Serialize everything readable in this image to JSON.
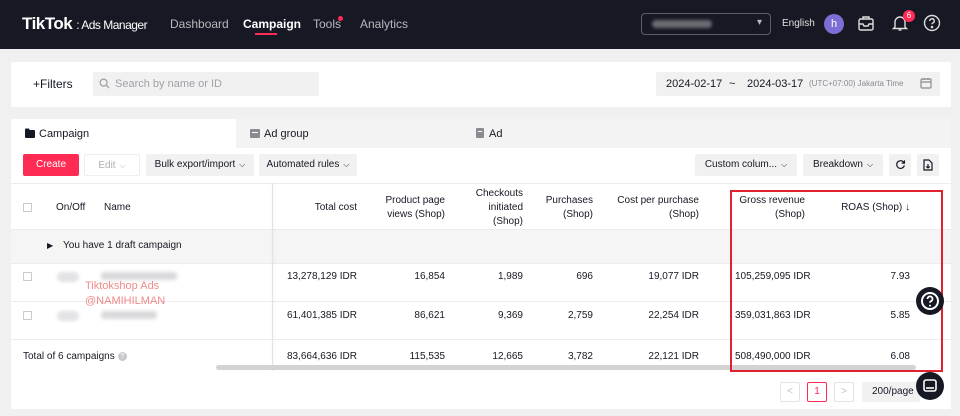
{
  "topnav": {
    "brand": "TikTok",
    "brand_sub": ": Ads Manager",
    "items": [
      {
        "label": "Dashboard"
      },
      {
        "label": "Campaign"
      },
      {
        "label": "Tools"
      },
      {
        "label": "Analytics"
      }
    ],
    "language": "English",
    "avatar_letter": "h",
    "notification_count": "6"
  },
  "filterbar": {
    "filters_label": "+Filters",
    "search_placeholder": "Search by name or ID",
    "date_start": "2024-02-17",
    "date_sep": "~",
    "date_end": "2024-03-17",
    "timezone": "(UTC+07:00) Jakarta Time"
  },
  "tabs": [
    {
      "label": "Campaign"
    },
    {
      "label": "Ad group"
    },
    {
      "label": "Ad"
    }
  ],
  "toolbar": {
    "create": "Create",
    "edit": "Edit",
    "bulk": "Bulk export/import",
    "rules": "Automated rules",
    "custom_columns": "Custom colum...",
    "breakdown": "Breakdown"
  },
  "table": {
    "headers": {
      "onoff": "On/Off",
      "name": "Name",
      "total_cost": "Total cost",
      "ppv_1": "Product page",
      "ppv_2": "views (Shop)",
      "checkouts_1": "Checkouts",
      "checkouts_2": "initiated",
      "checkouts_3": "(Shop)",
      "purchases_1": "Purchases",
      "purchases_2": "(Shop)",
      "cpp_1": "Cost per purchase",
      "cpp_2": "(Shop)",
      "gross_1": "Gross revenue",
      "gross_2": "(Shop)",
      "roas": "ROAS (Shop) ↓"
    },
    "draft_text": "You have 1 draft campaign",
    "rows": [
      {
        "total_cost": "13,278,129 IDR",
        "ppv": "16,854",
        "checkouts": "1,989",
        "purchases": "696",
        "cpp": "19,077 IDR",
        "gross": "105,259,095 IDR",
        "roas": "7.93"
      },
      {
        "total_cost": "61,401,385 IDR",
        "ppv": "86,621",
        "checkouts": "9,369",
        "purchases": "2,759",
        "cpp": "22,254 IDR",
        "gross": "359,031,863 IDR",
        "roas": "5.85"
      }
    ],
    "total": {
      "label": "Total of 6 campaigns",
      "total_cost": "83,664,636 IDR",
      "ppv": "115,535",
      "checkouts": "12,665",
      "purchases": "3,782",
      "cpp": "22,121 IDR",
      "gross": "508,490,000 IDR",
      "roas": "6.08"
    }
  },
  "watermark": {
    "line1": "Tiktokshop Ads",
    "line2": "@NAMIHILMAN"
  },
  "pagination": {
    "prev": "<",
    "current": "1",
    "next": ">",
    "page_size": "200/page"
  },
  "colors": {
    "accent": "#fe2c55",
    "highlight_box": "#e0222e",
    "nav_bg": "#161823"
  }
}
